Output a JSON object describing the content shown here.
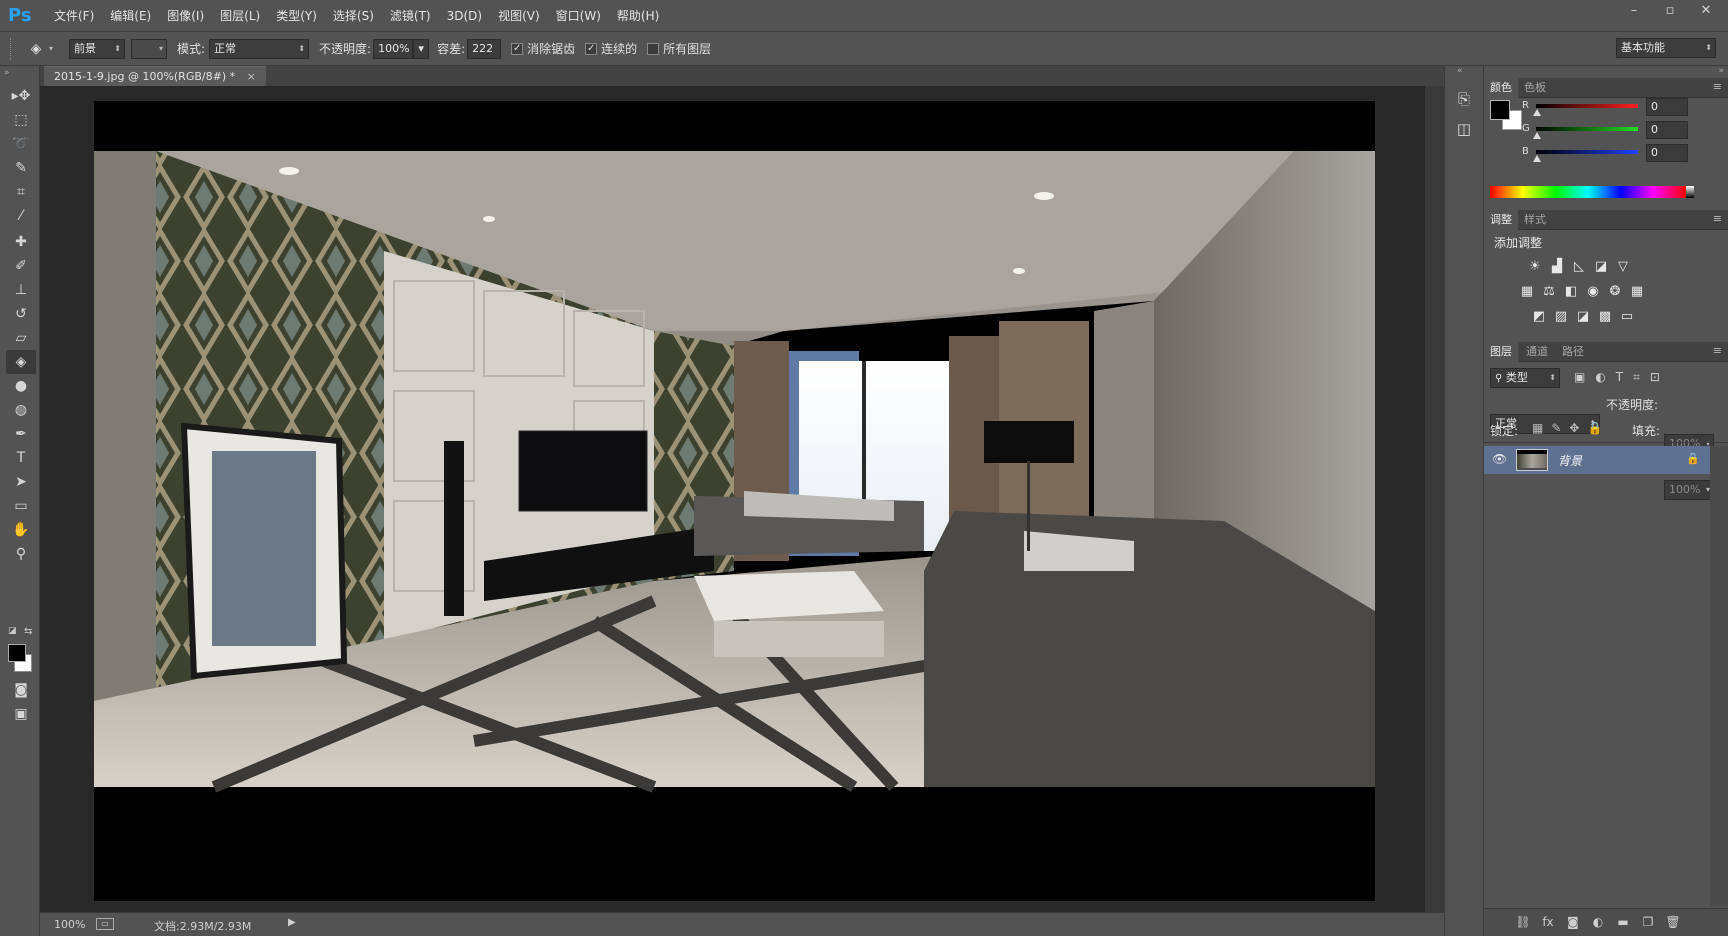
{
  "app": {
    "logo": "Ps",
    "menu": [
      "文件(F)",
      "编辑(E)",
      "图像(I)",
      "图层(L)",
      "类型(Y)",
      "选择(S)",
      "滤镜(T)",
      "3D(D)",
      "视图(V)",
      "窗口(W)",
      "帮助(H)"
    ],
    "window_controls": [
      "–",
      "▫",
      "✕"
    ]
  },
  "options": {
    "tool_icon": "paint-bucket-icon",
    "fill_source": "前景",
    "mode_label": "模式:",
    "mode_value": "正常",
    "opacity_label": "不透明度:",
    "opacity_value": "100%",
    "tolerance_label": "容差:",
    "tolerance_value": "222",
    "antialias_label": "消除锯齿",
    "antialias_checked": true,
    "contiguous_label": "连续的",
    "contiguous_checked": true,
    "all_layers_label": "所有图层",
    "all_layers_checked": false,
    "workspace": "基本功能"
  },
  "toolbar": {
    "tools": [
      {
        "name": "move-tool",
        "glyph": "▸✥"
      },
      {
        "name": "marquee-tool",
        "glyph": "⬚"
      },
      {
        "name": "lasso-tool",
        "glyph": "➰"
      },
      {
        "name": "quick-select-tool",
        "glyph": "✎"
      },
      {
        "name": "crop-tool",
        "glyph": "⌗"
      },
      {
        "name": "eyedropper-tool",
        "glyph": "⁄"
      },
      {
        "name": "healing-brush-tool",
        "glyph": "✚"
      },
      {
        "name": "brush-tool",
        "glyph": "✐"
      },
      {
        "name": "clone-stamp-tool",
        "glyph": "⊥"
      },
      {
        "name": "history-brush-tool",
        "glyph": "↺"
      },
      {
        "name": "eraser-tool",
        "glyph": "▱"
      },
      {
        "name": "paint-bucket-tool",
        "glyph": "◈",
        "active": true
      },
      {
        "name": "blur-tool",
        "glyph": "●"
      },
      {
        "name": "dodge-tool",
        "glyph": "◍"
      },
      {
        "name": "pen-tool",
        "glyph": "✒"
      },
      {
        "name": "type-tool",
        "glyph": "T"
      },
      {
        "name": "path-select-tool",
        "glyph": "➤"
      },
      {
        "name": "shape-tool",
        "glyph": "▭"
      },
      {
        "name": "hand-tool",
        "glyph": "✋"
      },
      {
        "name": "zoom-tool",
        "glyph": "⚲"
      }
    ],
    "foreground_color": "#000000",
    "background_color": "#ffffff"
  },
  "document": {
    "tab_title": "2015-1-9.jpg @ 100%(RGB/8#) *",
    "tab_close": "×",
    "zoom": "100%",
    "doc_size": "文档:2.93M/2.93M"
  },
  "color_panel": {
    "tabs": [
      "颜色",
      "色板"
    ],
    "channels": [
      {
        "label": "R",
        "value": "0",
        "color": "#ff2020"
      },
      {
        "label": "G",
        "value": "0",
        "color": "#20e020"
      },
      {
        "label": "B",
        "value": "0",
        "color": "#2040ff"
      }
    ]
  },
  "adjust_panel": {
    "tabs": [
      "调整",
      "样式"
    ],
    "title": "添加调整",
    "icons": [
      [
        "brightness-icon",
        "levels-icon",
        "curves-icon",
        "exposure-icon",
        "vibrance-icon"
      ],
      [
        "hue-saturation-icon",
        "color-balance-icon",
        "black-white-icon",
        "photo-filter-icon",
        "channel-mixer-icon",
        "color-lookup-icon"
      ],
      [
        "invert-icon",
        "posterize-icon",
        "threshold-icon",
        "selective-color-icon",
        "gradient-map-icon"
      ]
    ],
    "glyphs": [
      [
        "☀",
        "▟",
        "◺",
        "◪",
        "▽"
      ],
      [
        "▦",
        "⚖",
        "◧",
        "◉",
        "❂",
        "▦"
      ],
      [
        "◩",
        "▨",
        "◪",
        "▩",
        "▭"
      ]
    ]
  },
  "layers_panel": {
    "tabs": [
      "图层",
      "通道",
      "路径"
    ],
    "filter_label": "类型",
    "blend_mode": "正常",
    "opacity_label": "不透明度:",
    "opacity_value": "100%",
    "lock_label": "锁定:",
    "fill_label": "填充:",
    "fill_value": "100%",
    "layers": [
      {
        "name": "背景",
        "visible": true,
        "locked": true,
        "selected": true
      }
    ],
    "footer_icons": [
      "link-icon",
      "fx-icon",
      "mask-icon",
      "adjustment-icon",
      "group-icon",
      "new-layer-icon",
      "trash-icon"
    ],
    "footer_glyphs": [
      "⛓",
      "fx",
      "◙",
      "◐",
      "▬",
      "❐",
      "🗑"
    ]
  }
}
